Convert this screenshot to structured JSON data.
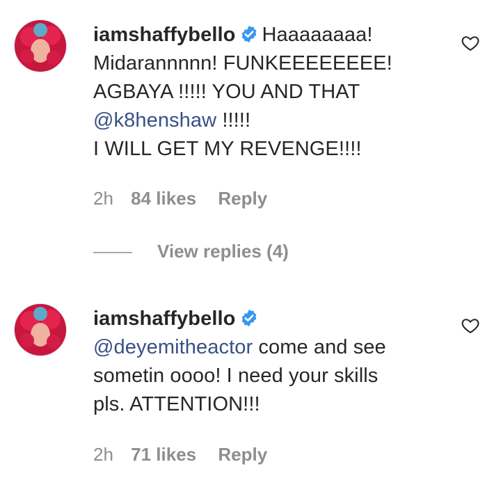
{
  "comments": [
    {
      "username": "iamshaffybello",
      "verified": true,
      "text_segments": {
        "p1": "Haaaaaaaa!",
        "p2": "Midarannnnn! FUNKEEEEEEEE!",
        "p3": "AGBAYA !!!!! YOU AND THAT",
        "mention": "@k8henshaw",
        "p4": " !!!!!",
        "p5": "I WILL GET MY REVENGE!!!!"
      },
      "time": "2h",
      "likes": "84 likes",
      "reply_label": "Reply",
      "view_replies": "View replies (4)"
    },
    {
      "username": "iamshaffybello",
      "verified": true,
      "text_segments": {
        "mention": "@deyemitheactor",
        "p1": " come and see",
        "p2": "sometin oooo! I need your skills",
        "p3": "pls. ATTENTION!!!"
      },
      "time": "2h",
      "likes": "71 likes",
      "reply_label": "Reply"
    }
  ],
  "colors": {
    "text": "#262626",
    "muted": "#8e8e8e",
    "mention": "#385185",
    "verified": "#3897f0"
  }
}
